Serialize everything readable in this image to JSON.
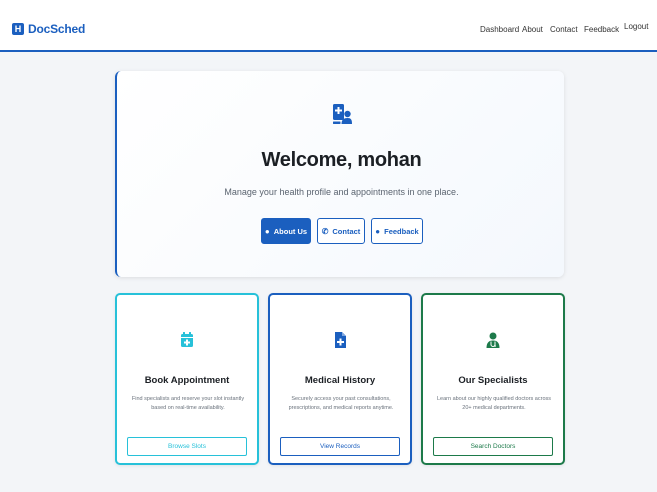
{
  "navbar": {
    "brand_icon": "H",
    "brand": "DocSched",
    "links": [
      "Dashboard",
      "About",
      "Contact",
      "Feedback",
      "Logout"
    ]
  },
  "welcome": {
    "title": "Welcome, mohan",
    "subtitle": "Manage your health profile and appointments in one place.",
    "buttons": [
      "About Us",
      "Contact",
      "Feedback"
    ]
  },
  "cards": [
    {
      "title": "Book Appointment",
      "desc": "Find specialists and reserve your slot instantly based on real-time availability.",
      "button": "Browse Slots",
      "icon": "calendar-icon",
      "color": "#27c1d9"
    },
    {
      "title": "Medical History",
      "desc": "Securely access your past consultations, prescriptions, and medical reports anytime.",
      "button": "View Records",
      "icon": "document-medical-icon",
      "color": "#1b5fbf"
    },
    {
      "title": "Our Specialists",
      "desc": "Learn about our highly qualified doctors across 20+ medical departments.",
      "button": "Search Doctors",
      "icon": "doctor-icon",
      "color": "#1d7a4a"
    }
  ],
  "colors": {
    "primary": "#1b5fbf",
    "teal": "#27c1d9",
    "green": "#1d7a4a",
    "background": "#f3f5f8"
  }
}
